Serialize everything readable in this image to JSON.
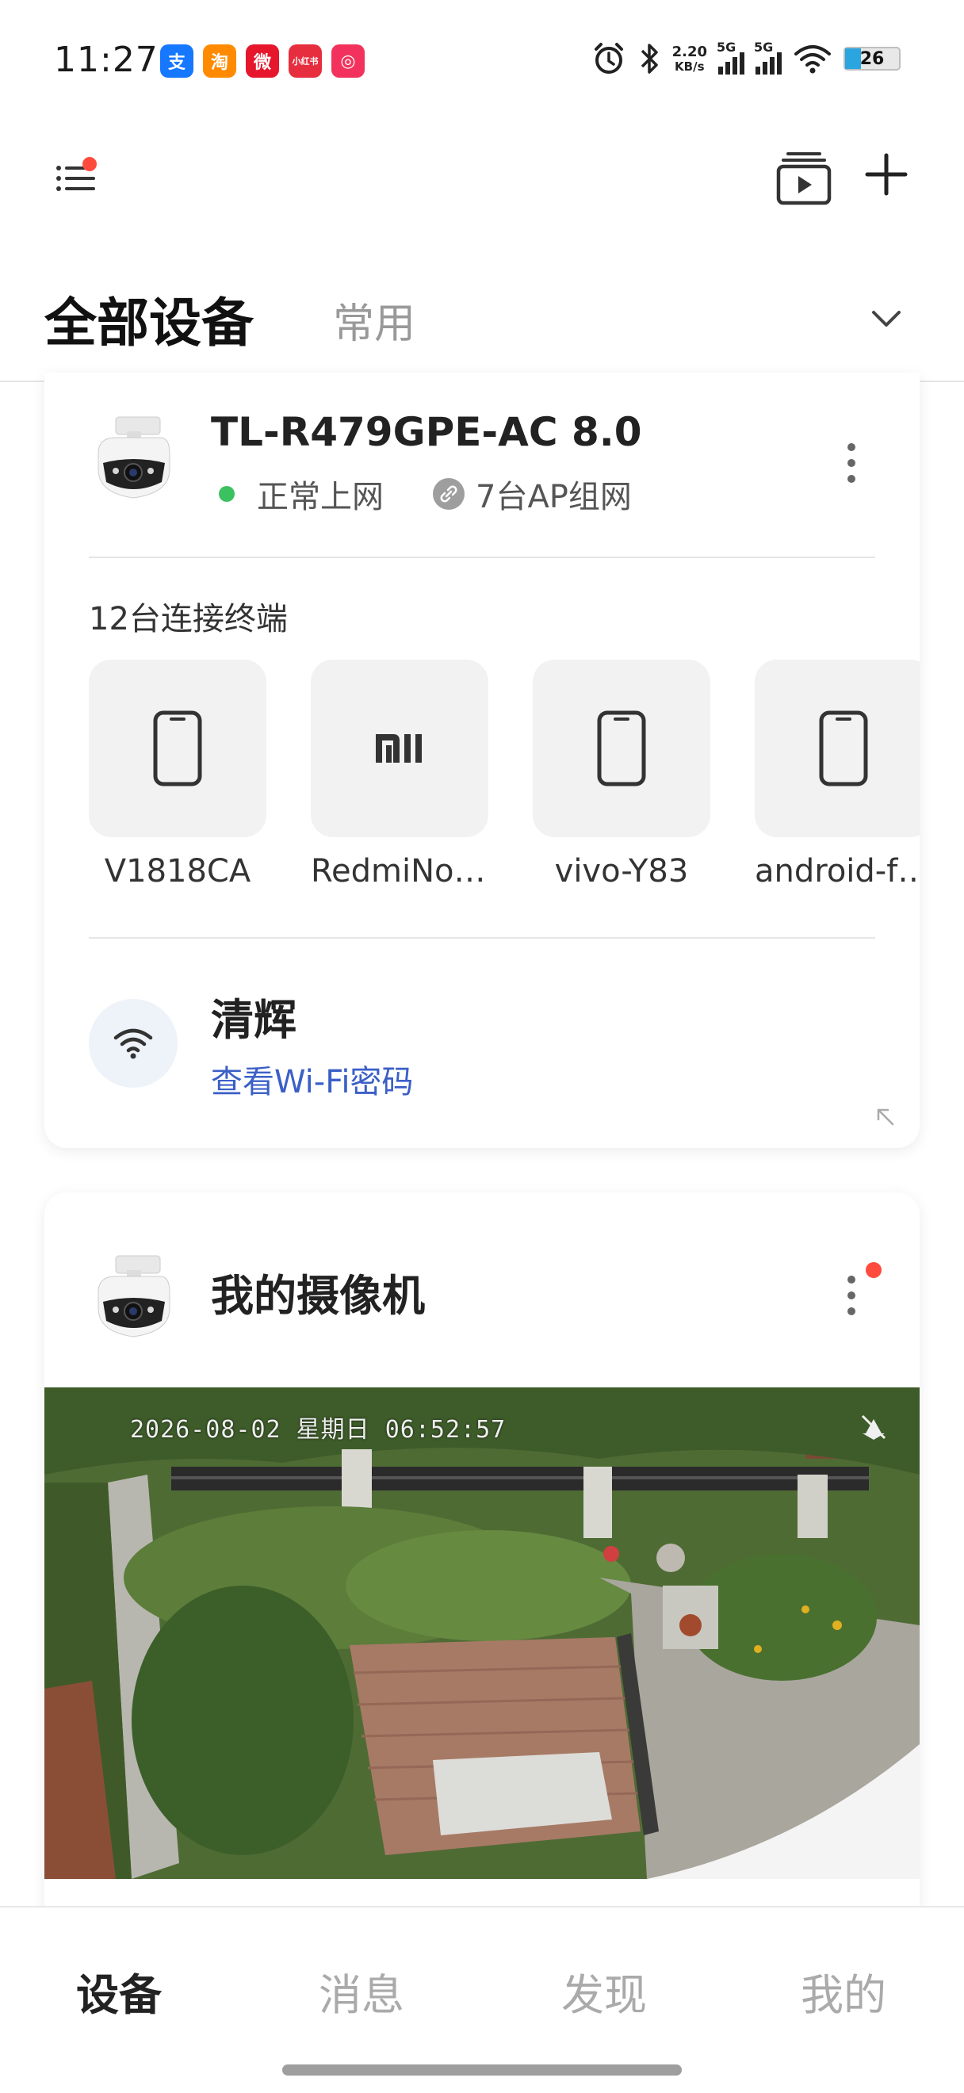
{
  "status_bar": {
    "time": "11:27",
    "notifications": [
      {
        "icon": "alipay-icon",
        "text": "支",
        "color": "#1677ff"
      },
      {
        "icon": "taobao-icon",
        "text": "淘",
        "color": "#ff8a00"
      },
      {
        "icon": "weibo-icon",
        "text": "微",
        "color": "#e6162d"
      },
      {
        "icon": "xiaohongshu-icon",
        "text": "小红书",
        "color": "#e62e3f"
      },
      {
        "icon": "app-icon",
        "text": "◎",
        "color": "#f2325c"
      }
    ],
    "net_speed_value": "2.20",
    "net_speed_unit": "KB/s",
    "signal1_label": "5G",
    "signal2_label": "5G",
    "battery": "26"
  },
  "tabs": {
    "all_devices": "全部设备",
    "common": "常用"
  },
  "router_card": {
    "name": "TL-R479GPE-AC 8.0",
    "status": "正常上网",
    "ap_group": "7台AP组网",
    "terminal_count": "12台连接终端",
    "devices": [
      {
        "name": "V1818CA",
        "icon": "phone-icon"
      },
      {
        "name": "RedmiNot…",
        "icon": "xiaomi-logo-icon"
      },
      {
        "name": "vivo-Y83",
        "icon": "phone-icon"
      },
      {
        "name": "android-f8…",
        "icon": "phone-icon"
      }
    ],
    "wifi_name": "清辉",
    "wifi_link": "查看Wi-Fi密码"
  },
  "camera_card": {
    "title": "我的摄像机",
    "osd_timestamp": "2026-08-02 星期日 06:52:57"
  },
  "bottom_nav": {
    "devices": "设备",
    "messages": "消息",
    "discover": "发现",
    "mine": "我的"
  },
  "colors": {
    "accent": "#3b5fc7",
    "status_green": "#3cc160",
    "badge_red": "#ff4b3e"
  }
}
